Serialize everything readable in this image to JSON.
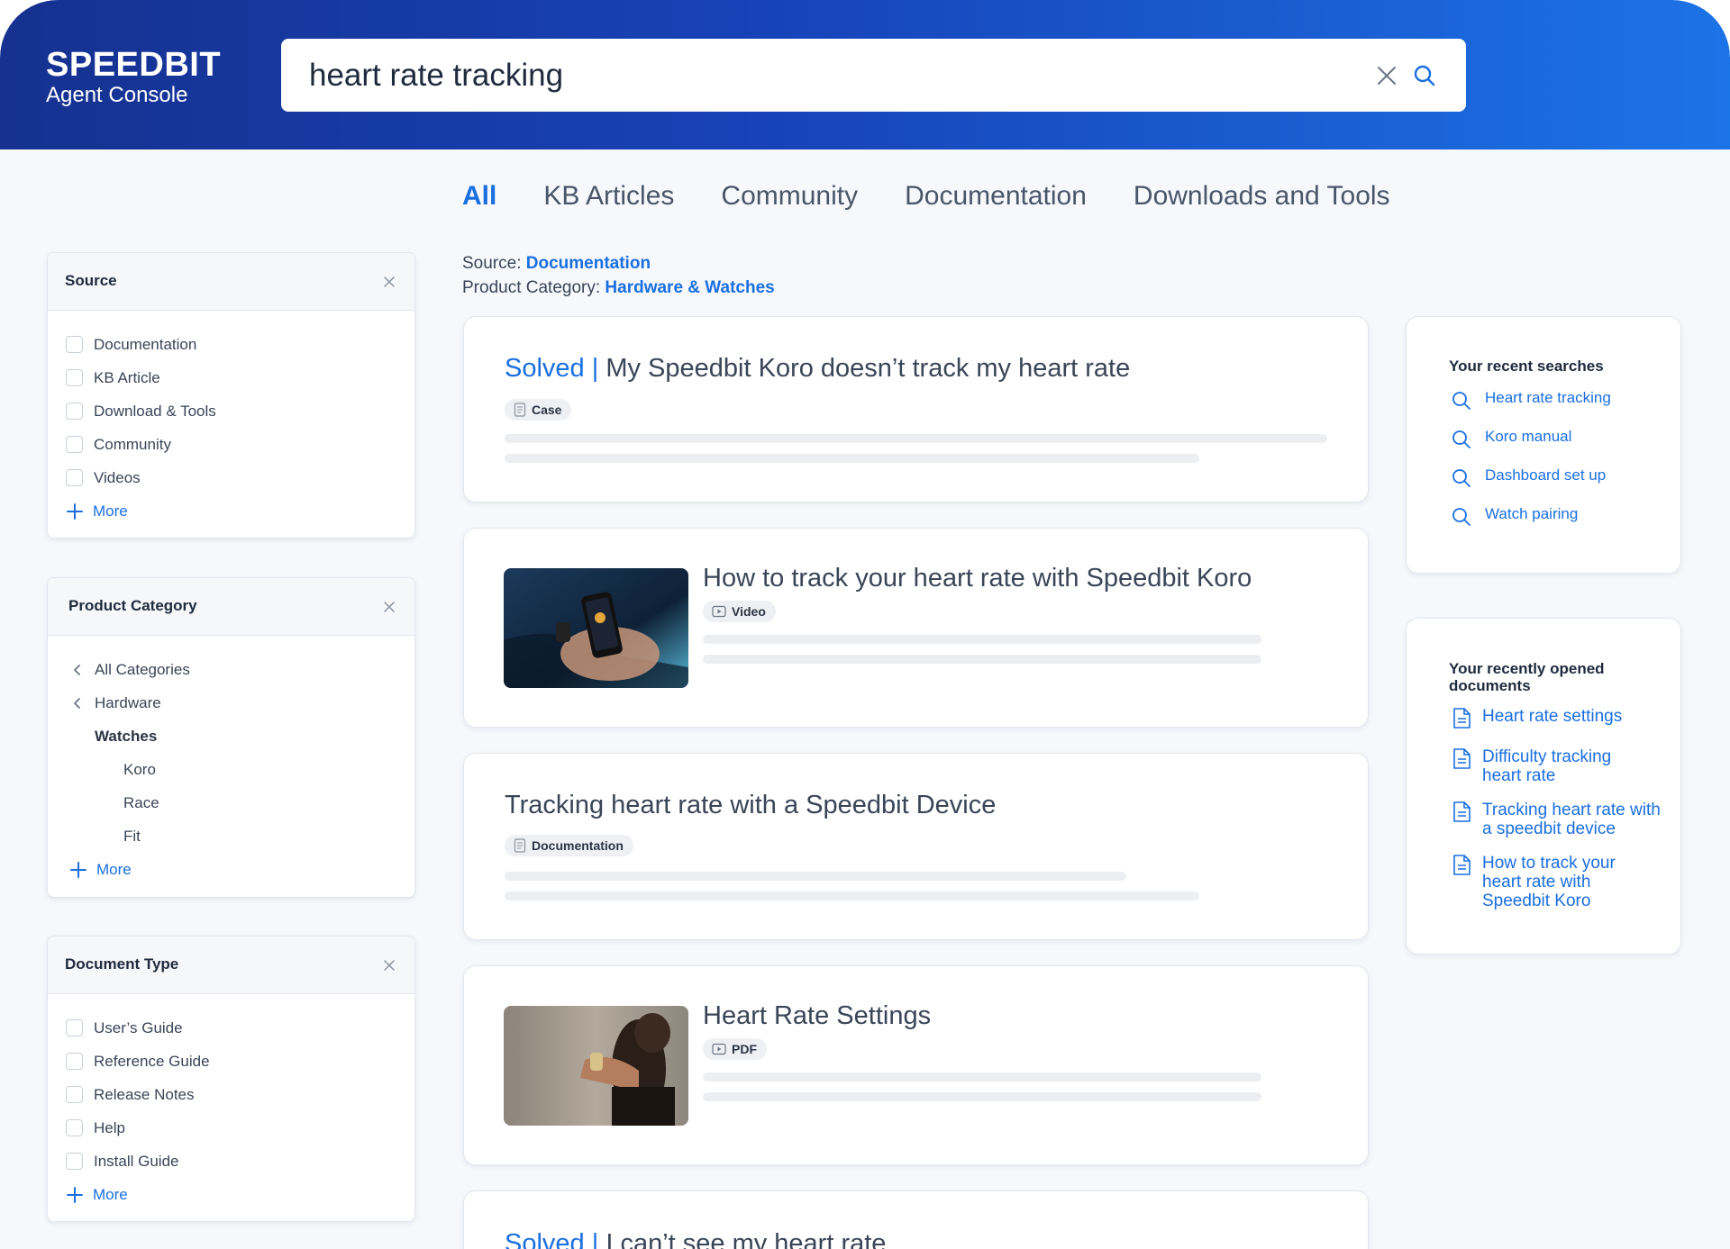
{
  "brand": {
    "name": "SPEEDBIT",
    "subtitle": "Agent Console"
  },
  "search": {
    "query": "heart rate tracking"
  },
  "tabs": [
    "All",
    "KB Articles",
    "Community",
    "Documentation",
    "Downloads and Tools"
  ],
  "active_tab": "All",
  "filters": {
    "source_label": "Source:",
    "source_value": "Documentation",
    "category_label": "Product Category:",
    "category_value": "Hardware & Watches"
  },
  "facets": {
    "source": {
      "title": "Source",
      "options": [
        "Documentation",
        "KB Article",
        "Download & Tools",
        "Community",
        "Videos"
      ],
      "more": "More"
    },
    "category": {
      "title": "Product Category",
      "path": [
        "All Categories",
        "Hardware"
      ],
      "current": "Watches",
      "children": [
        "Koro",
        "Race",
        "Fit"
      ],
      "more": "More"
    },
    "doctype": {
      "title": "Document Type",
      "options": [
        "User’s Guide",
        "Reference Guide",
        "Release Notes",
        "Help",
        "Install Guide"
      ],
      "more": "More"
    }
  },
  "results": [
    {
      "solved": "Solved",
      "separator": "|",
      "title": "My Speedbit Koro doesn’t track my heart rate",
      "badge": "Case"
    },
    {
      "title": "How to track your heart rate with Speedbit Koro",
      "badge": "Video"
    },
    {
      "title": "Tracking heart rate with a Speedbit Device",
      "badge": "Documentation"
    },
    {
      "title": "Heart Rate Settings",
      "badge": "PDF"
    },
    {
      "solved": "Solved",
      "separator": "|",
      "title": "I can’t see my heart rate"
    }
  ],
  "recent_searches": {
    "title": "Your recent searches",
    "items": [
      "Heart rate tracking",
      "Koro manual",
      "Dashboard set up",
      "Watch pairing"
    ]
  },
  "recent_documents": {
    "title": "Your recently opened documents",
    "items": [
      "Heart rate settings",
      "Difficulty tracking heart rate",
      "Tracking heart rate with a speedbit device",
      "How to track your heart rate with Speedbit Koro"
    ]
  },
  "colors": {
    "accent": "#1a6fe0",
    "header_start": "#16318f",
    "header_end": "#1c73e6"
  }
}
